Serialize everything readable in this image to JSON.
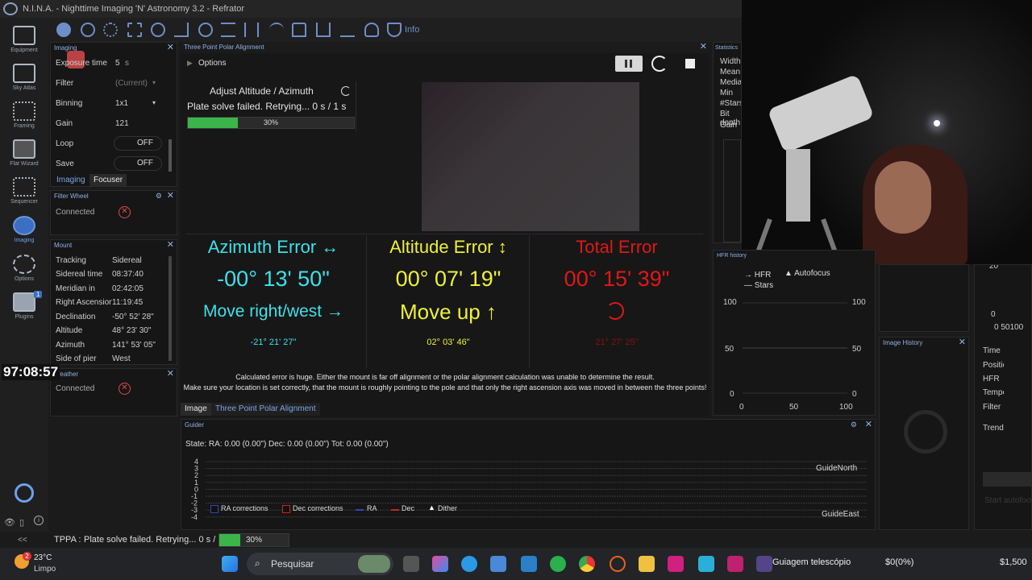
{
  "window": {
    "title": "N.I.N.A. - Nighttime Imaging 'N' Astronomy 3.2  -  Refrator"
  },
  "nav": [
    {
      "label": "Equipment"
    },
    {
      "label": "Sky Atlas"
    },
    {
      "label": "Framing"
    },
    {
      "label": "Flat Wizard"
    },
    {
      "label": "Sequencer"
    },
    {
      "label": "Imaging"
    },
    {
      "label": "Options"
    },
    {
      "label": "Plugins"
    }
  ],
  "nav_badge": "1",
  "toolbar": {
    "info_label": "Info"
  },
  "imaging": {
    "header": "Imaging",
    "rows": [
      {
        "label": "Exposure time",
        "value": "5",
        "unit": "s"
      },
      {
        "label": "Filter",
        "value": "(Current)"
      },
      {
        "label": "Binning",
        "value": "1x1"
      },
      {
        "label": "Gain",
        "value": "121"
      },
      {
        "label": "Loop",
        "value": "OFF"
      },
      {
        "label": "Save",
        "value": "OFF"
      }
    ],
    "tabs": [
      "Imaging",
      "Focuser"
    ]
  },
  "filterwheel": {
    "header": "Filter Wheel",
    "status": "Connected"
  },
  "mount": {
    "header": "Mount",
    "rows": [
      {
        "label": "Tracking",
        "value": "Sidereal"
      },
      {
        "label": "Sidereal time",
        "value": "08:37:40"
      },
      {
        "label": "Meridian in",
        "value": "02:42:05"
      },
      {
        "label": "Right Ascension",
        "value": "11:19:45"
      },
      {
        "label": "Declination",
        "value": "-50° 52' 28\""
      },
      {
        "label": "Altitude",
        "value": "48° 23' 30\""
      },
      {
        "label": "Azimuth",
        "value": "141° 53' 05\""
      },
      {
        "label": "Side of pier",
        "value": "West"
      }
    ]
  },
  "overlay_timer": "97:08:57",
  "weather": {
    "header": "Weather",
    "status": "Connected"
  },
  "tppa": {
    "header": "Three Point Polar Alignment",
    "options_label": "Options",
    "step": "Adjust Altitude / Azimuth",
    "status": "Plate solve failed. Retrying... 0 s / 1 s",
    "progress_text": "30%",
    "progress": 0.3,
    "azimuth": {
      "title": "Azimuth Error ↔",
      "value": "-00° 13' 50\"",
      "move": "Move right/west →",
      "small": "-21° 21' 27\""
    },
    "altitude": {
      "title": "Altitude Error ↕",
      "value": "00° 07' 19\"",
      "move": "Move up ↑",
      "small": "02° 03' 46\""
    },
    "total": {
      "title": "Total Error",
      "value": "00° 15' 39\"",
      "small": "21° 27' 25\""
    },
    "message1": "Calculated error is huge. Either the mount is far off alignment or the polar alignment calculation was unable to determine the result.",
    "message2": "Make sure your location is set correctly, that the mount is roughly pointing to the pole and that only the right ascension axis was moved in between the three points!",
    "tabs": [
      "Image",
      "Three Point Polar Alignment"
    ]
  },
  "statistics": {
    "header": "Statistics",
    "rows": [
      "Width",
      "Mean",
      "Median",
      "Min",
      "#Stars",
      "Bit depth",
      "Gain"
    ]
  },
  "hfr": {
    "header": "HFR history",
    "legend": [
      "HFR",
      "Autofocus",
      "Stars"
    ],
    "y_ticks": [
      "100",
      "50",
      "0"
    ],
    "x_ticks": [
      "0",
      "50",
      "100"
    ]
  },
  "image_history": {
    "header": "Image History"
  },
  "right_panel": {
    "ticks": [
      "20",
      "0",
      "0 50100"
    ],
    "rows": [
      "Time",
      "Position",
      "HFR",
      "Temperature",
      "Filter",
      "Trend"
    ],
    "start_label": "Start autofocus"
  },
  "guider": {
    "header": "Guider",
    "state": "State:  RA: 0.00 (0.00\")  Dec: 0.00 (0.00\")  Tot: 0.00 (0.00\")",
    "y_ticks": [
      "4",
      "3",
      "2",
      "1",
      "0",
      "-1",
      "-2",
      "-3",
      "-4"
    ],
    "label_north": "GuideNorth",
    "label_east": "GuideEast",
    "legend": [
      "RA corrections",
      "Dec corrections",
      "RA",
      "Dec",
      "Dither"
    ]
  },
  "statusbar": {
    "collapse": "<<",
    "label": "TPPA :",
    "text": "Plate solve failed. Retrying... 0 s / 1 s",
    "progress_text": "30%",
    "progress": 0.3
  },
  "taskbar": {
    "temp": "23°C",
    "weather": "Limpo",
    "badge": "2",
    "search": "Pesquisar",
    "app_title": "Guiagem telescópio",
    "money": "$0(0%)",
    "price": "$1,500"
  },
  "colors": {
    "cyan": "#3fe0e8",
    "yellow": "#eef03a",
    "red": "#e01818",
    "accent": "#6ea0f0"
  }
}
